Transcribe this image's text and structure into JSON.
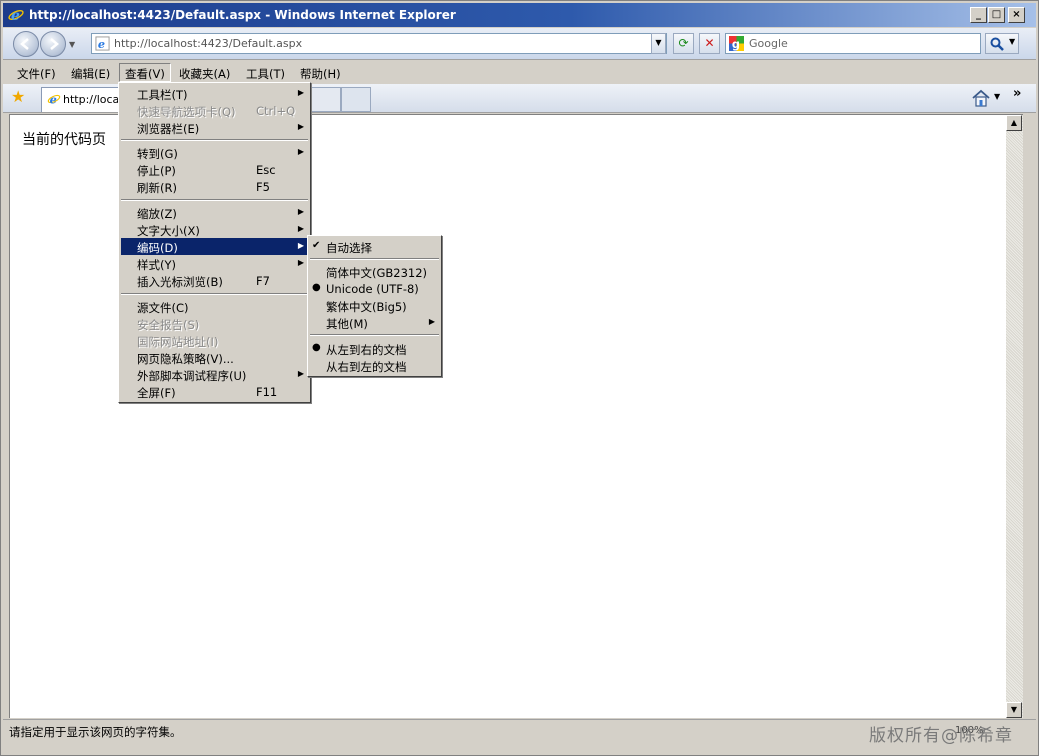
{
  "window": {
    "title": "http://localhost:4423/Default.aspx - Windows Internet Explorer",
    "caption_buttons": {
      "minimize": "_",
      "maximize": "□",
      "close": "×"
    }
  },
  "address_bar": {
    "url": "http://localhost:4423/Default.aspx",
    "search_placeholder": "Google"
  },
  "menubar": {
    "items": [
      "文件(F)",
      "编辑(E)",
      "查看(V)",
      "收藏夹(A)",
      "工具(T)",
      "帮助(H)"
    ],
    "active": "查看(V)"
  },
  "tab": {
    "label": "http://localhost:4423/Default.aspx"
  },
  "content": {
    "text": "当前的代码页"
  },
  "view_menu": {
    "items": [
      {
        "label": "工具栏(T)",
        "submenu": true
      },
      {
        "label": "快速导航选项卡(Q)",
        "shortcut": "Ctrl+Q",
        "disabled": true
      },
      {
        "label": "浏览器栏(E)",
        "submenu": true
      },
      {
        "label": "转到(G)",
        "submenu": true
      },
      {
        "label": "停止(P)",
        "shortcut": "Esc"
      },
      {
        "label": "刷新(R)",
        "shortcut": "F5"
      },
      {
        "label": "缩放(Z)",
        "submenu": true
      },
      {
        "label": "文字大小(X)",
        "submenu": true
      },
      {
        "label": "编码(D)",
        "submenu": true,
        "highlighted": true
      },
      {
        "label": "样式(Y)",
        "submenu": true
      },
      {
        "label": "插入光标浏览(B)",
        "shortcut": "F7"
      },
      {
        "label": "源文件(C)"
      },
      {
        "label": "安全报告(S)",
        "disabled": true
      },
      {
        "label": "国际网站地址(I)",
        "disabled": true
      },
      {
        "label": "网页隐私策略(V)..."
      },
      {
        "label": "外部脚本调试程序(U)",
        "submenu": true
      },
      {
        "label": "全屏(F)",
        "shortcut": "F11"
      }
    ]
  },
  "encoding_menu": {
    "items": [
      {
        "label": "自动选择",
        "mark": "✔"
      },
      {
        "label": "简体中文(GB2312)"
      },
      {
        "label": "Unicode (UTF-8)",
        "mark": "●"
      },
      {
        "label": "繁体中文(Big5)"
      },
      {
        "label": "其他(M)",
        "submenu": true
      },
      {
        "label": "从左到右的文档",
        "mark": "●"
      },
      {
        "label": "从右到左的文档"
      }
    ]
  },
  "statusbar": {
    "text": "请指定用于显示该网页的字符集。",
    "zoom": "100%",
    "watermark": "版权所有@陈希章"
  },
  "colors": {
    "titlebar_start": "#1c3c8c",
    "menu_highlight": "#0a246a",
    "chrome": "#d4d0c8"
  }
}
